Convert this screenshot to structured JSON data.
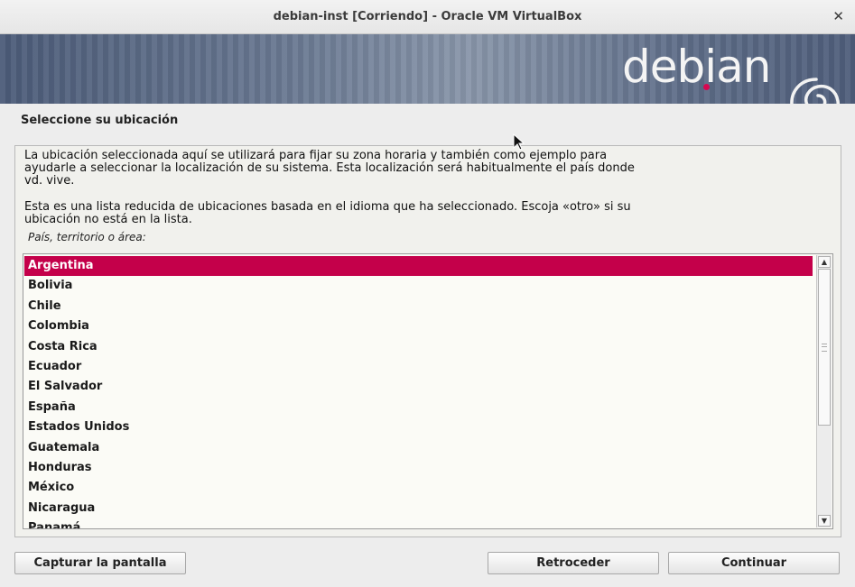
{
  "window": {
    "title": "debian-inst [Corriendo] - Oracle VM VirtualBox"
  },
  "banner": {
    "logo_text": "debian"
  },
  "page": {
    "heading": "Seleccione su ubicación",
    "description_1": "La ubicación seleccionada aquí se utilizará para fijar su zona horaria y también como ejemplo para\nayudarle a seleccionar la localización de su sistema. Esta localización será habitualmente el país donde\nvd. vive.",
    "description_2": "Esta es una lista reducida de ubicaciones basada en el idioma que ha seleccionado. Escoja «otro» si su\nubicación no está en la lista.",
    "field_label": "País, territorio o área:"
  },
  "country_list": {
    "items": [
      "Argentina",
      "Bolivia",
      "Chile",
      "Colombia",
      "Costa Rica",
      "Ecuador",
      "El Salvador",
      "España",
      "Estados Unidos",
      "Guatemala",
      "Honduras",
      "México",
      "Nicaragua",
      "Panamá"
    ],
    "selected": "Argentina"
  },
  "buttons": {
    "screenshot": "Capturar la pantalla",
    "back": "Retroceder",
    "continue": "Continuar"
  },
  "colors": {
    "selection": "#c4004a",
    "logo_dot": "#d70751"
  }
}
